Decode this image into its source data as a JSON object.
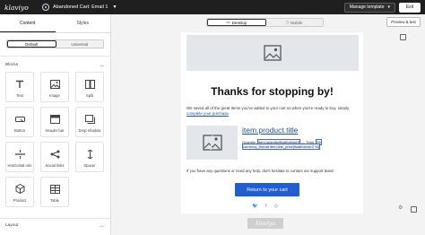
{
  "topbar": {
    "logo": "klaviyo",
    "title": "Abandoned Cart: Email 1",
    "manage_label": "Manage template",
    "exit_label": "Exit"
  },
  "left_panel": {
    "tabs": [
      {
        "label": "Content",
        "active": true
      },
      {
        "label": "Styles",
        "active": false
      }
    ],
    "segment": [
      {
        "label": "Default",
        "active": true
      },
      {
        "label": "Universal",
        "active": false
      }
    ],
    "blocks_header": "Blocks",
    "blocks": [
      {
        "label": "Text",
        "icon": "text-t-icon"
      },
      {
        "label": "Image",
        "icon": "image-icon"
      },
      {
        "label": "Split",
        "icon": "split-icon"
      },
      {
        "label": "Button",
        "icon": "button-icon"
      },
      {
        "label": "Header bar",
        "icon": "header-bar-icon"
      },
      {
        "label": "Drop shadow",
        "icon": "drop-shadow-icon"
      },
      {
        "label": "Horizontal rule",
        "icon": "horizontal-rule-icon"
      },
      {
        "label": "Social links",
        "icon": "social-links-icon"
      },
      {
        "label": "Spacer",
        "icon": "spacer-icon"
      },
      {
        "label": "Product",
        "icon": "product-cube-icon"
      },
      {
        "label": "Table",
        "icon": "table-icon"
      }
    ],
    "layout_header": "Layout"
  },
  "viewport": {
    "desktop_label": "Desktop",
    "mobile_label": "Mobile",
    "active": "Desktop"
  },
  "preview_label": "Preview & test",
  "email": {
    "headline": "Thanks for stopping by!",
    "para_prefix": "We saved all of the great items you've added to your cart so when you're ready to buy, simply",
    "para_link": "complete your purchase",
    "para_suffix": ".",
    "product_title": "item.product.title",
    "quantity_prefix": "Quantity:",
    "quantity_var": "item.quantity|floatformat:0",
    "total_prefix": "— Total:",
    "total_var": "{%",
    "currency_line": "currency_format item.line_price|floatformat:2 %}",
    "help_text": "If you have any questions or need any help, don't hesitate to contact our support team!",
    "cta_label": "Return to your cart",
    "footer_logo": "klaviyo"
  },
  "colors": {
    "topbar_bg": "#1f1f1f",
    "accent_blue": "#1f5fd1",
    "link_blue": "#1a4ecf",
    "placeholder_gray": "#e3e6ea"
  }
}
